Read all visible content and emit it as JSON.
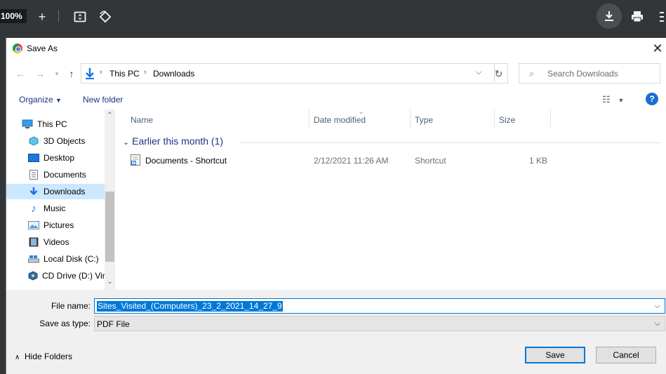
{
  "viewer": {
    "zoom": "100%",
    "icons": [
      "plus-icon",
      "fit-page-icon",
      "rotate-icon",
      "download-icon",
      "print-icon",
      "more-icon"
    ]
  },
  "dialog": {
    "title": "Save As",
    "address": {
      "crumbs": [
        "This PC",
        "Downloads"
      ]
    },
    "search_placeholder": "Search Downloads",
    "toolbar": {
      "organize": "Organize",
      "new_folder": "New folder",
      "help": "?"
    },
    "tree": [
      {
        "label": "This PC",
        "icon": "computer-icon"
      },
      {
        "label": "3D Objects",
        "icon": "3d-objects-icon"
      },
      {
        "label": "Desktop",
        "icon": "desktop-icon"
      },
      {
        "label": "Documents",
        "icon": "documents-icon"
      },
      {
        "label": "Downloads",
        "icon": "downloads-icon",
        "selected": true
      },
      {
        "label": "Music",
        "icon": "music-icon"
      },
      {
        "label": "Pictures",
        "icon": "pictures-icon"
      },
      {
        "label": "Videos",
        "icon": "videos-icon"
      },
      {
        "label": "Local Disk (C:)",
        "icon": "disk-icon"
      },
      {
        "label": "CD Drive (D:) Vir",
        "icon": "cd-drive-icon"
      }
    ],
    "columns": [
      "Name",
      "Date modified",
      "Type",
      "Size"
    ],
    "group": "Earlier this month (1)",
    "files": [
      {
        "name": "Documents - Shortcut",
        "date": "2/12/2021 11:26 AM",
        "type": "Shortcut",
        "size": "1 KB"
      }
    ],
    "file_name_label": "File name:",
    "file_name": "Sites_Visited_(Computers)_23_2_2021_14_27_9",
    "save_type_label": "Save as type:",
    "save_type": "PDF File",
    "hide_folders": "Hide Folders",
    "save": "Save",
    "cancel": "Cancel"
  },
  "colors": {
    "accent": "#0078d7",
    "link": "#1e3287",
    "selection": "#cce8ff"
  }
}
